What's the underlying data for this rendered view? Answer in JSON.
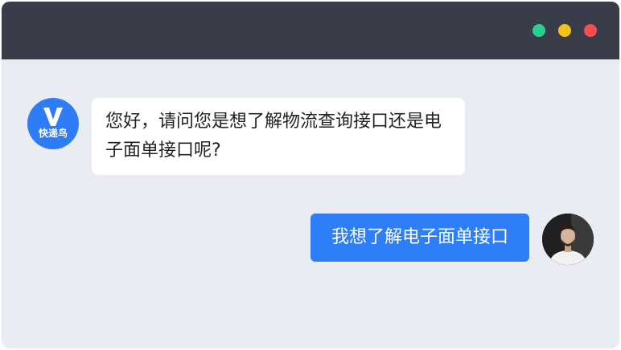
{
  "window": {
    "colors": {
      "titlebar": "#393d4a",
      "background": "#e9edf3",
      "dot_green": "#27d28e",
      "dot_yellow": "#f6c21a",
      "dot_red": "#f5504f"
    }
  },
  "chat": {
    "bot": {
      "avatar_logo_text": "快递鸟",
      "avatar_icon": "v-logo-icon",
      "accent": "#2f7df6",
      "message": "您好，请问您是想了解物流查询接口还是电子面单接口呢?"
    },
    "user": {
      "message": "我想了解电子面单接口",
      "bubble_color": "#2d7ef7",
      "avatar_icon": "user-photo"
    }
  }
}
